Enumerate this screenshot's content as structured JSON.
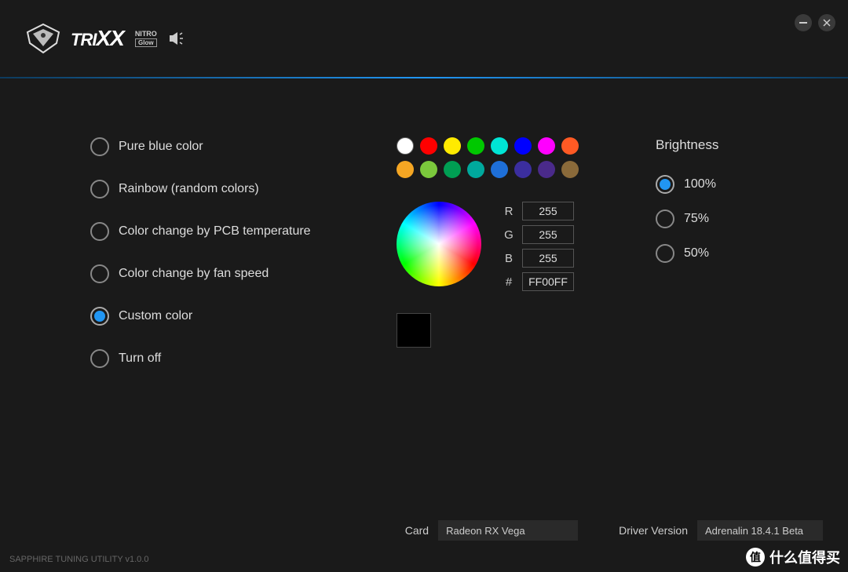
{
  "header": {
    "product_line": "TRI",
    "product_suffix": "XX",
    "sub_badge_top": "NITRO",
    "sub_badge_bottom": "Glow"
  },
  "modes": [
    {
      "id": "pure-blue",
      "label": "Pure blue color",
      "selected": false
    },
    {
      "id": "rainbow",
      "label": "Rainbow (random colors)",
      "selected": false
    },
    {
      "id": "pcb-temp",
      "label": "Color change by PCB temperature",
      "selected": false
    },
    {
      "id": "fan-speed",
      "label": "Color change by fan speed",
      "selected": false
    },
    {
      "id": "custom",
      "label": "Custom color",
      "selected": true
    },
    {
      "id": "off",
      "label": "Turn off",
      "selected": false
    }
  ],
  "swatches": [
    "#ffffff",
    "#ff0000",
    "#ffea00",
    "#00c800",
    "#00e5d5",
    "#0000ff",
    "#ff00ff",
    "#ff5a24",
    "#f5a623",
    "#7bc83c",
    "#009e53",
    "#00a99d",
    "#1e6fd8",
    "#3b2e9e",
    "#4a2a8a",
    "#8a6a3a"
  ],
  "rgb": {
    "r_label": "R",
    "r_value": "255",
    "g_label": "G",
    "g_value": "255",
    "b_label": "B",
    "b_value": "255",
    "hex_label": "#",
    "hex_value": "FF00FF"
  },
  "brightness": {
    "title": "Brightness",
    "options": [
      {
        "id": "b100",
        "label": "100%",
        "selected": true
      },
      {
        "id": "b75",
        "label": "75%",
        "selected": false
      },
      {
        "id": "b50",
        "label": "50%",
        "selected": false
      }
    ]
  },
  "footer": {
    "card_label": "Card",
    "card_value": "Radeon RX Vega",
    "driver_label": "Driver Version",
    "driver_value": "Adrenalin 18.4.1 Beta",
    "version_text": "SAPPHIRE TUNING UTILITY v1.0.0"
  },
  "watermark": "什么值得买"
}
